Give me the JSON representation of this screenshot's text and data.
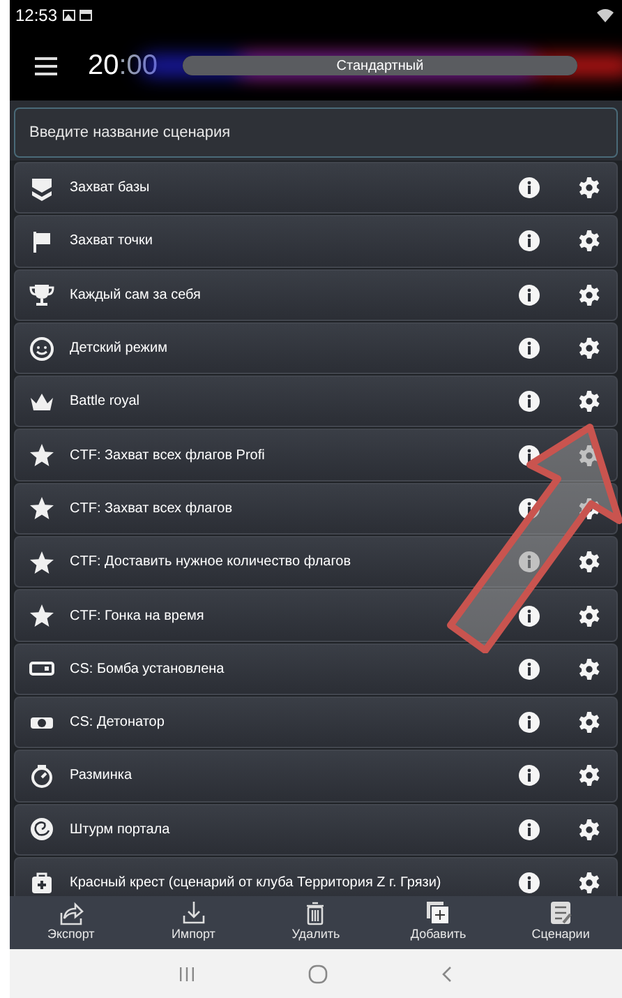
{
  "status_bar": {
    "time": "12:53"
  },
  "header": {
    "timer_minutes": "20",
    "timer_seconds": ":00",
    "mode": "Стандартный"
  },
  "search": {
    "placeholder": "Введите название сценария"
  },
  "scenarios": [
    {
      "name": "Захват базы"
    },
    {
      "name": "Захват точки"
    },
    {
      "name": "Каждый сам за себя"
    },
    {
      "name": "Детский режим"
    },
    {
      "name": "Battle royal"
    },
    {
      "name": "CTF: Захват всех флагов Profi"
    },
    {
      "name": "CTF: Захват всех флагов"
    },
    {
      "name": "CTF: Доставить нужное количество флагов"
    },
    {
      "name": "CTF: Гонка на время"
    },
    {
      "name": "CS: Бомба установлена"
    },
    {
      "name": "CS: Детонатор"
    },
    {
      "name": "Разминка"
    },
    {
      "name": "Штурм портала"
    },
    {
      "name": "Красный крест (сценарий от клуба Территория Z г. Грязи)"
    }
  ],
  "toolbar": [
    {
      "label": "Экспорт"
    },
    {
      "label": "Импорт"
    },
    {
      "label": "Удалить"
    },
    {
      "label": "Добавить"
    },
    {
      "label": "Сценарии"
    }
  ]
}
